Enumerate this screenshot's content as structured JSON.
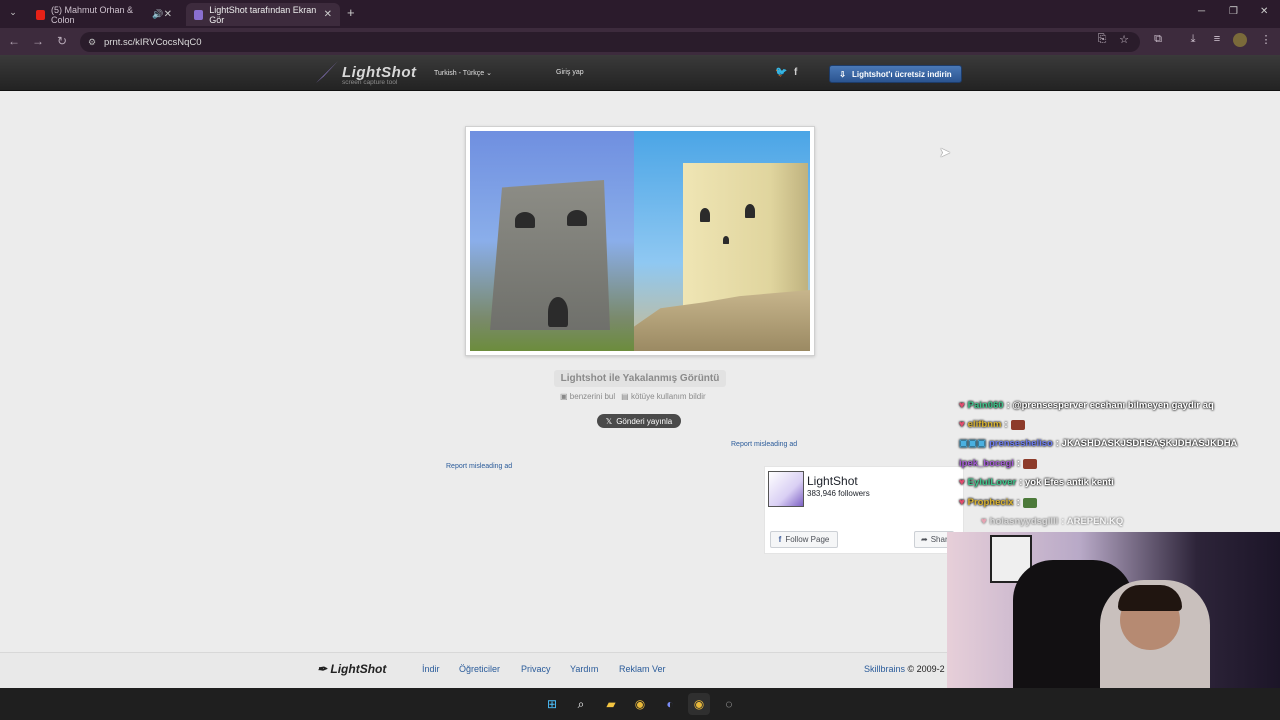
{
  "browser": {
    "tabs": [
      {
        "label": "(5) Mahmut Orhan & Colon",
        "active": false
      },
      {
        "label": "LightShot tarafından Ekran Gör",
        "active": true
      }
    ],
    "new_tab": "+",
    "url": "prnt.sc/kIRVCocsNqC0"
  },
  "lightshot": {
    "logo_title": "LightShot",
    "logo_sub": "screen capture tool",
    "language": "Turkish - Türkçe",
    "login": "Giriş yap",
    "download_button": "Lightshot'ı ücretsiz indirin"
  },
  "main": {
    "caption": "Lightshot ile Yakalanmış Görüntü",
    "find_similar": "benzerini bul",
    "report_abuse": "kötüye kullanım bildir",
    "post_button": "Gönderi yayınla",
    "report_ad_1": "Report misleading ad",
    "report_ad_2": "Report misleading ad"
  },
  "facebook": {
    "title": "LightShot",
    "followers": "383,946 followers",
    "follow_button": "Follow Page",
    "share_button": "Shar"
  },
  "footer": {
    "logo": "LightShot",
    "links": [
      "İndir",
      "Öğreticiler",
      "Privacy",
      "Yardım",
      "Reklam Ver"
    ],
    "company": "Skillbrains",
    "copyright": "© 2009-2"
  },
  "chat": [
    {
      "user": "Pain060",
      "text": ": @prensesperver ecehanı bilmeyen gaydir aq",
      "color": "#3fc48b"
    },
    {
      "user": "elifbnm",
      "text": ":",
      "color": "#d8b230"
    },
    {
      "user": "prensesheliso",
      "text": ": JKASHDASKJSDHSAŞKJDHASJKDHA",
      "color": "#6d7df0"
    },
    {
      "user": "ipek_bocegi",
      "text": ":",
      "color": "#a45cd6"
    },
    {
      "user": "EylulLover",
      "text": ": yok Efes antik kenti",
      "color": "#3fc48b"
    },
    {
      "user": "Prophecix",
      "text": ":",
      "color": "#d8b230"
    },
    {
      "user": "holasnyydsgllll",
      "text": ": AREPEN.KQ",
      "color": "#bbbbbb"
    }
  ],
  "colors": {
    "accent": "#2b5591",
    "link": "#2a5b9a"
  }
}
